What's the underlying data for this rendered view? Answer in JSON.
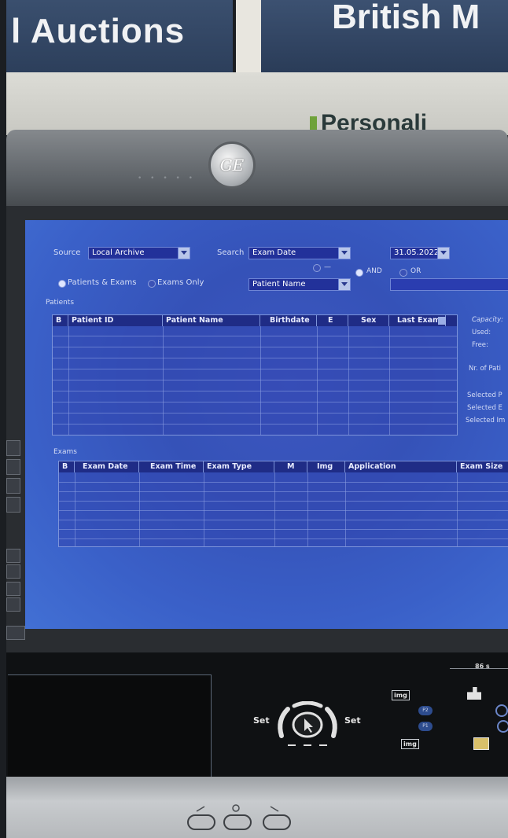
{
  "background": {
    "banner_left_text": "l Auctions",
    "banner_right_text": "British M",
    "wall_sign_text": "Personali",
    "logo_text": "GE"
  },
  "toolbar": {
    "source_label": "Source",
    "source_value": "Local Archive",
    "search_label": "Search",
    "search_value": "Exam Date",
    "date_value": "31.05.2022",
    "dash_label": "—",
    "and_label": "AND",
    "or_label": "OR",
    "scope_patients_exams": "Patients & Exams",
    "scope_exams_only": "Exams Only",
    "second_search_value": "Patient Name"
  },
  "patients": {
    "section_label": "Patients",
    "columns": [
      "B",
      "Patient ID",
      "Patient Name",
      "Birthdate",
      "E",
      "Sex",
      "Last Exam"
    ]
  },
  "archive_info": {
    "capacity_label": "Capacity:",
    "used_label": "Used:",
    "free_label": "Free:",
    "nr_patients_label": "Nr. of Pati",
    "selected_p_label": "Selected P",
    "selected_e_label": "Selected E",
    "selected_i_label": "Selected Im"
  },
  "exams": {
    "section_label": "Exams",
    "columns": [
      "B",
      "Exam Date",
      "Exam Time",
      "Exam Type",
      "M",
      "Img",
      "Application",
      "Exam Size"
    ]
  },
  "controls": {
    "set_left": "Set",
    "set_right": "Set",
    "img_icon_1": "img",
    "img_icon_2": "img",
    "p2_label": "P2",
    "p1_label": "P1",
    "readout": "86 s"
  },
  "colors": {
    "screen_blue": "#3a58c2",
    "header_navy": "#1f2c86",
    "grid_line": "#7d94da"
  }
}
